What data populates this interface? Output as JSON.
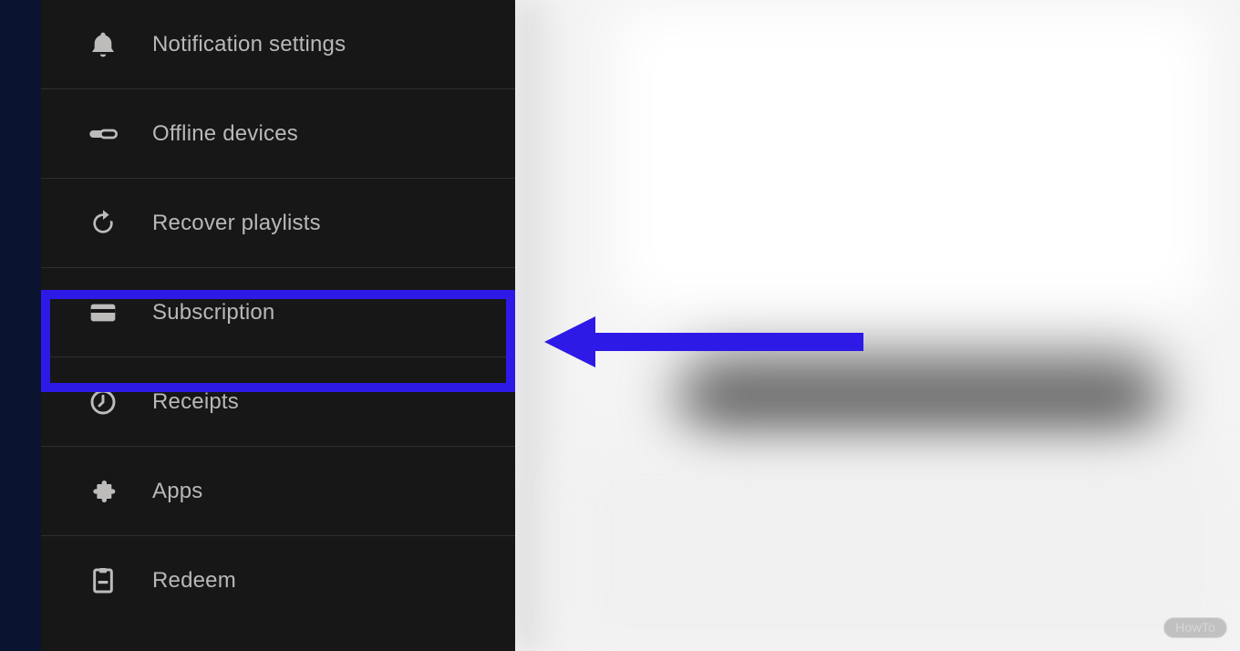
{
  "colors": {
    "highlight": "#2e1ae6"
  },
  "sidebar": {
    "items": [
      {
        "label": "Notification settings",
        "icon": "bell-icon",
        "highlighted": false
      },
      {
        "label": "Offline devices",
        "icon": "toggle-icon",
        "highlighted": false
      },
      {
        "label": "Recover playlists",
        "icon": "refresh-icon",
        "highlighted": false
      },
      {
        "label": "Subscription",
        "icon": "card-icon",
        "highlighted": true
      },
      {
        "label": "Receipts",
        "icon": "clock-icon",
        "highlighted": false
      },
      {
        "label": "Apps",
        "icon": "puzzle-icon",
        "highlighted": false
      },
      {
        "label": "Redeem",
        "icon": "redeem-icon",
        "highlighted": false
      }
    ]
  },
  "watermark": "HowTo"
}
